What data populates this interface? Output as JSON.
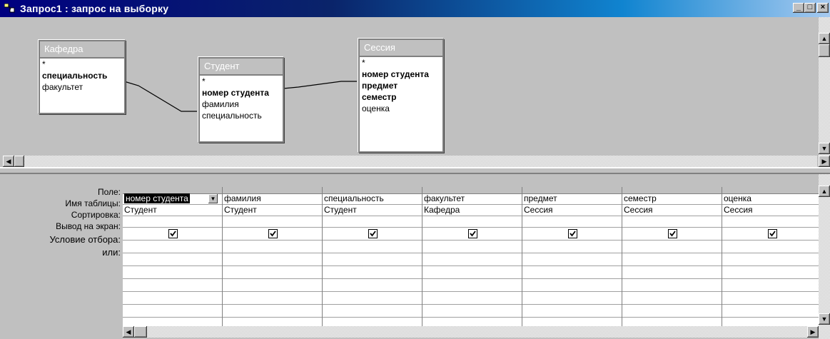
{
  "window": {
    "title": "Запрос1 : запрос на выборку",
    "min_label": "_",
    "max_label": "□",
    "close_label": "×"
  },
  "tables": [
    {
      "name": "Кафедра",
      "fields": [
        {
          "label": "*",
          "key": false
        },
        {
          "label": "специальность",
          "key": true
        },
        {
          "label": "факультет",
          "key": false
        }
      ]
    },
    {
      "name": "Студент",
      "fields": [
        {
          "label": "*",
          "key": false
        },
        {
          "label": "номер студента",
          "key": true
        },
        {
          "label": "фамилия",
          "key": false
        },
        {
          "label": "специальность",
          "key": false
        }
      ]
    },
    {
      "name": "Сессия",
      "fields": [
        {
          "label": "*",
          "key": false
        },
        {
          "label": "номер студента",
          "key": true
        },
        {
          "label": "предмет",
          "key": true
        },
        {
          "label": "семестр",
          "key": true
        },
        {
          "label": "оценка",
          "key": false
        }
      ]
    }
  ],
  "grid": {
    "row_labels": [
      "Поле:",
      "Имя таблицы:",
      "Сортировка:",
      "Вывод на экран:",
      "Условие отбора:",
      "или:"
    ],
    "columns": [
      {
        "field": "номер студента",
        "table": "Студент",
        "show": true
      },
      {
        "field": "фамилия",
        "table": "Студент",
        "show": true
      },
      {
        "field": "специальность",
        "table": "Студент",
        "show": true
      },
      {
        "field": "факультет",
        "table": "Кафедра",
        "show": true
      },
      {
        "field": "предмет",
        "table": "Сессия",
        "show": true
      },
      {
        "field": "семестр",
        "table": "Сессия",
        "show": true
      },
      {
        "field": "оценка",
        "table": "Сессия",
        "show": true
      }
    ]
  },
  "icons": {
    "window": "query-window-icon",
    "dropdown": "dropdown-arrow-icon",
    "check": "checkmark-icon",
    "scroll_left": "arrow-left-icon",
    "scroll_right": "arrow-right-icon",
    "scroll_up": "arrow-up-icon",
    "scroll_down": "arrow-down-icon"
  },
  "colors": {
    "title_bar_start": "#000080",
    "title_bar_end": "#a6caf0",
    "window_face": "#c0c0c0",
    "selection": "#000000"
  }
}
